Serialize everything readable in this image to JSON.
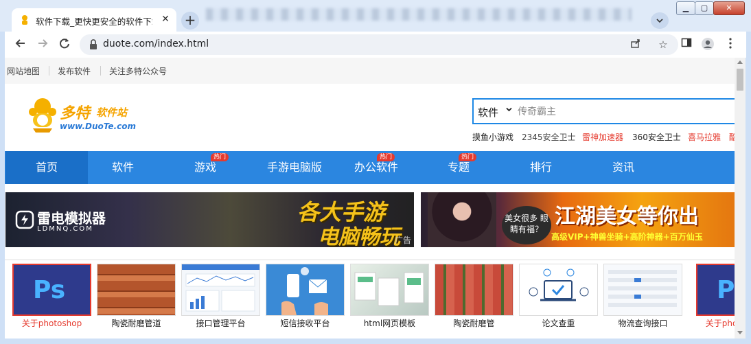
{
  "browser": {
    "tab_title": "软件下载_更快更安全的软件下载",
    "tab_close": "✕",
    "new_tab": "+",
    "url": "duote.com/index.html",
    "window_controls": {
      "minimize": "▁",
      "maximize": "▢",
      "close": "✕"
    }
  },
  "topbar": {
    "links": [
      "网站地图",
      "发布软件",
      "关注多特公众号"
    ]
  },
  "logo": {
    "name": "多特",
    "suffix": "软件站",
    "url_text": "www.DuoTe.com"
  },
  "search": {
    "category": "软件",
    "placeholder": "传奇霸主"
  },
  "hot_links": [
    {
      "label": "摸鱼小游戏",
      "color": "#222222"
    },
    {
      "label": "2345安全卫士",
      "color": "#444444"
    },
    {
      "label": "雷神加速器",
      "color": "#e53a2e"
    },
    {
      "label": "360安全卫士",
      "color": "#222222"
    },
    {
      "label": "喜马拉雅",
      "color": "#e53a2e"
    },
    {
      "label": "酷",
      "color": "#e53a2e"
    }
  ],
  "nav": {
    "items": [
      "首页",
      "软件",
      "游戏",
      "手游电脑版",
      "办公软件",
      "专题",
      "排行",
      "资讯"
    ],
    "badge": "热门",
    "active_index": 0
  },
  "banners": {
    "left": {
      "brand": "雷电模拟器",
      "brand_sub": "LDMNQ.COM",
      "title_line1": "各大手游",
      "title_line2": "电脑畅玩",
      "ad_label": "广告"
    },
    "right": {
      "bubble": "美女很多 眼睛有福？",
      "title": "江湖美女等你出",
      "subtitle": "高级VIP+神兽坐骑+高阶神器+百万仙玉"
    }
  },
  "thumbnails": [
    {
      "label": "关于photoshop",
      "highlight": true
    },
    {
      "label": "陶瓷耐磨管道",
      "highlight": false
    },
    {
      "label": "接口管理平台",
      "highlight": false
    },
    {
      "label": "短信接收平台",
      "highlight": false
    },
    {
      "label": "html网页模板",
      "highlight": false
    },
    {
      "label": "陶瓷耐磨管",
      "highlight": false
    },
    {
      "label": "论文查重",
      "highlight": false
    },
    {
      "label": "物流查询接口",
      "highlight": false
    },
    {
      "label": "关于photoshop",
      "highlight": true
    }
  ],
  "thumb_icon_text": "Ps",
  "colors": {
    "nav_bg": "#2b86e0",
    "nav_active": "#1a6fc8",
    "accent_red": "#e53a2e",
    "logo_orange": "#f5a400"
  }
}
